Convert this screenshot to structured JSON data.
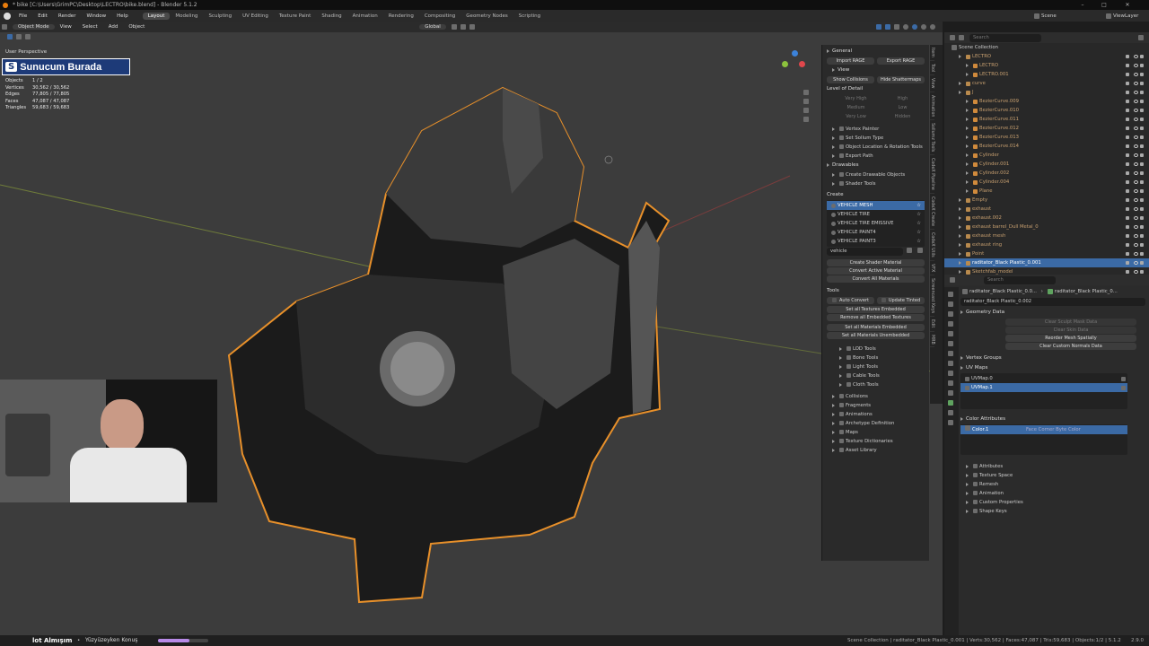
{
  "window": {
    "title": "* bike [C:\\Users\\GrimPC\\Desktop\\LECTRO\\bike.blend] - Blender 5.1.2"
  },
  "menu": [
    "File",
    "Edit",
    "Render",
    "Window",
    "Help"
  ],
  "workspaces": [
    {
      "label": "Layout",
      "active": true
    },
    {
      "label": "Modeling",
      "active": false
    },
    {
      "label": "Sculpting",
      "active": false
    },
    {
      "label": "UV Editing",
      "active": false
    },
    {
      "label": "Texture Paint",
      "active": false
    },
    {
      "label": "Shading",
      "active": false
    },
    {
      "label": "Animation",
      "active": false
    },
    {
      "label": "Rendering",
      "active": false
    },
    {
      "label": "Compositing",
      "active": false
    },
    {
      "label": "Geometry Nodes",
      "active": false
    },
    {
      "label": "Scripting",
      "active": false
    }
  ],
  "scene": {
    "name": "Scene",
    "view_layer": "ViewLayer"
  },
  "viewport_header": {
    "mode": "Object Mode",
    "menus": [
      "View",
      "Select",
      "Add",
      "Object"
    ],
    "orientation": "Global",
    "options": "Options"
  },
  "viewport": {
    "perspective": "User Perspective",
    "logo_text": "Sunucum Burada",
    "logo_badge": "S",
    "stats": [
      {
        "label": "Objects",
        "value": "1 / 2"
      },
      {
        "label": "Vertices",
        "value": "30,562 / 30,562"
      },
      {
        "label": "Edges",
        "value": "77,805 / 77,805"
      },
      {
        "label": "Faces",
        "value": "47,087 / 47,087"
      },
      {
        "label": "Triangles",
        "value": "59,683 / 59,683"
      }
    ]
  },
  "npanel": {
    "general": "General",
    "import_btn": "Import RAGE",
    "export_btn": "Export RAGE",
    "view": "View",
    "show_collisions": "Show Collisions",
    "hide_shattermaps": "Hide Shattermaps",
    "lod_title": "Level of Detail",
    "lod_rows": [
      {
        "left": "Very High",
        "right": "High"
      },
      {
        "left": "Medium",
        "right": "Low"
      },
      {
        "left": "Very Low",
        "right": "Hidden"
      }
    ],
    "tools1": [
      "Vertex Painter",
      "Set Sollum Type",
      "Object Location & Rotation Tools",
      "Export Path"
    ],
    "drawables": "Drawables",
    "drawables_items": [
      "Create Drawable Objects",
      "Shader Tools"
    ],
    "create_title": "Create",
    "shader_list": [
      {
        "label": "VEHICLE MESH",
        "selected": true
      },
      {
        "label": "VEHICLE TIRE",
        "selected": false
      },
      {
        "label": "VEHICLE TIRE EMISSIVE",
        "selected": false
      },
      {
        "label": "VEHICLE PAINT4",
        "selected": false
      },
      {
        "label": "VEHICLE PAINT3",
        "selected": false
      }
    ],
    "search_value": "vehicle",
    "create_shader": "Create Shader Material",
    "convert_active": "Convert Active Material",
    "convert_all": "Convert All Materials",
    "tools_title": "Tools",
    "auto_convert": "Auto Convert",
    "update_tinted": "Update Tinted",
    "set_textures_embedded": "Set all Textures Embedded",
    "remove_embedded": "Remove all Embedded Textures",
    "set_materials_embedded": "Set all Materials Embedded",
    "set_materials_unembedded": "Set all Materials Unembedded",
    "subtools": [
      "LOD Tools",
      "Bone Tools",
      "Light Tools",
      "Cable Tools",
      "Cloth Tools"
    ],
    "sections": [
      "Collisions",
      "Fragments",
      "Animations",
      "Archetype Definition",
      "Maps",
      "Texture Dictionaries",
      "Asset Library"
    ]
  },
  "sidebar_tabs": [
    "Item",
    "Tool",
    "View",
    "Animation",
    "Sollumz Tools",
    "CodeX Pipeline",
    "CodeX Create",
    "CodeX Utils",
    "VFX",
    "Screencast Keys",
    "Edit",
    "MRB"
  ],
  "outliner": {
    "root": "Scene Collection",
    "search_placeholder": "Search",
    "items": [
      {
        "label": "LECTRO",
        "depth": 1
      },
      {
        "label": "LECTRO",
        "depth": 2
      },
      {
        "label": "LECTRO.001",
        "depth": 2
      },
      {
        "label": "curve",
        "depth": 1
      },
      {
        "label": "J",
        "depth": 1
      },
      {
        "label": "BezierCurve.009",
        "depth": 2
      },
      {
        "label": "BezierCurve.010",
        "depth": 2
      },
      {
        "label": "BezierCurve.011",
        "depth": 2
      },
      {
        "label": "BezierCurve.012",
        "depth": 2
      },
      {
        "label": "BezierCurve.013",
        "depth": 2
      },
      {
        "label": "BezierCurve.014",
        "depth": 2
      },
      {
        "label": "Cylinder",
        "depth": 2
      },
      {
        "label": "Cylinder.001",
        "depth": 2
      },
      {
        "label": "Cylinder.002",
        "depth": 2
      },
      {
        "label": "Cylinder.004",
        "depth": 2
      },
      {
        "label": "Plane",
        "depth": 2
      },
      {
        "label": "Empty",
        "depth": 1
      },
      {
        "label": "exhaust",
        "depth": 1
      },
      {
        "label": "exhaust.002",
        "depth": 1
      },
      {
        "label": "exhaust barrel_Dull Metal_0",
        "depth": 1
      },
      {
        "label": "exhaust mesh",
        "depth": 1
      },
      {
        "label": "exhaust ring",
        "depth": 1
      },
      {
        "label": "Point",
        "depth": 1
      },
      {
        "label": "raditator_Black Plastic_0.001",
        "depth": 1,
        "selected": true
      },
      {
        "label": "Sketchfab_model",
        "depth": 1
      },
      {
        "label": "Sketchfab_model.001",
        "depth": 1
      }
    ]
  },
  "properties": {
    "search_placeholder": "Search",
    "breadcrumb_obj": "raditator_Black Plastic_0.0...",
    "breadcrumb_mesh": "raditator_Black Plastic_0...",
    "mesh_name": "raditator_Black Plastic_0.002",
    "geometry_data": "Geometry Data",
    "clear_sculpt": "Clear Sculpt Mask Data",
    "clear_skin": "Clear Skin Data",
    "reorder": "Reorder Mesh Spatially",
    "clear_normals": "Clear Custom Normals Data",
    "vertex_groups": "Vertex Groups",
    "uv_maps": "UV Maps",
    "uv_list": [
      {
        "label": "UVMap.0",
        "selected": false
      },
      {
        "label": "UVMap.1",
        "selected": true
      }
    ],
    "color_attributes": "Color Attributes",
    "color_item": "Color.1",
    "color_item_info": "Face Corner  Byte Color",
    "sections": [
      "Attributes",
      "Texture Space",
      "Remesh",
      "Animation",
      "Custom Properties",
      "Shape Keys"
    ]
  },
  "status": {
    "overlay_text": "lot Almışım",
    "overlay_song": "Yüzyüzeyken Konuş",
    "progress": 0.62,
    "right": "Scene Collection | raditator_Black Plastic_0.001 | Verts:30,562 | Faces:47,087 | Tris:59,683 | Objects:1/2 | 5.1.2",
    "version": "2.9.0"
  },
  "colors": {
    "accent": "#3b6aa5",
    "outline": "#e8902a",
    "viewport_bg": "#3c3c3c"
  }
}
